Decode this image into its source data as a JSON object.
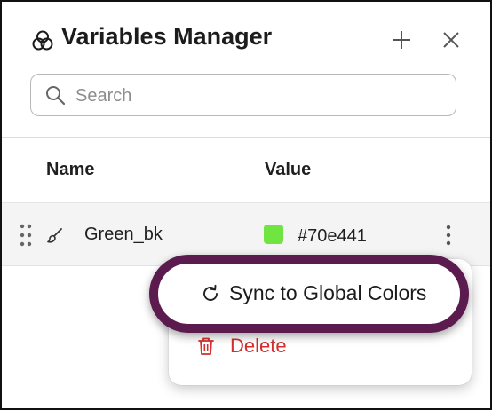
{
  "header": {
    "title": "Variables Manager",
    "title_icon": "variables-icon",
    "add_icon": "plus-icon",
    "close_icon": "close-icon"
  },
  "search": {
    "placeholder": "Search",
    "value": "",
    "icon": "search-icon"
  },
  "table": {
    "columns": [
      "Name",
      "Value"
    ],
    "rows": [
      {
        "name": "Green_bk",
        "type_icon": "brush-icon",
        "color": "#70e441",
        "value": "#70e441"
      }
    ]
  },
  "context_menu": {
    "items": [
      {
        "label": "Sync to Global Colors",
        "icon": "sync-icon",
        "highlighted": true
      },
      {
        "label": "Delete",
        "icon": "trash-icon",
        "color": "#d32f2f"
      }
    ]
  },
  "colors": {
    "highlight_ring": "#5c1b4f",
    "danger": "#d32f2f",
    "row_background": "#f4f4f4"
  }
}
